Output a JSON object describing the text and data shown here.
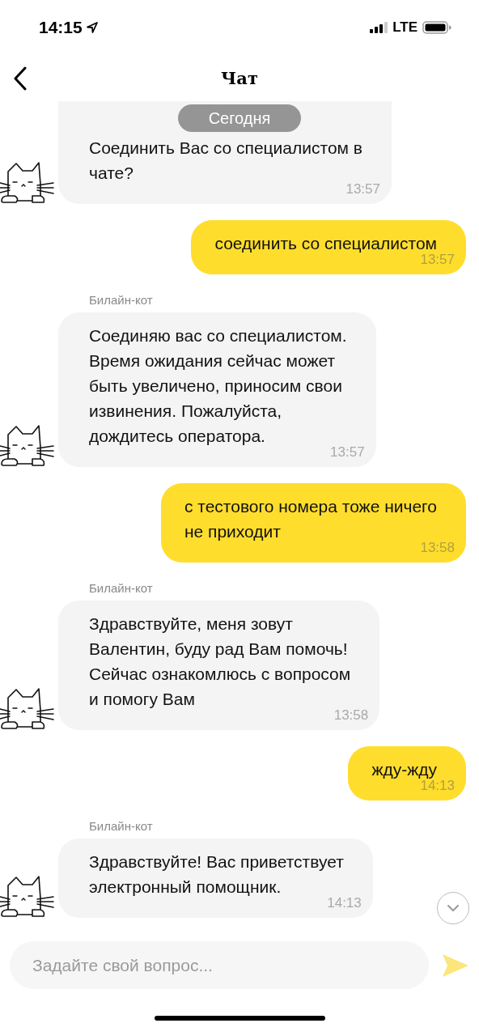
{
  "status_bar": {
    "time": "14:15",
    "network": "LTE"
  },
  "header": {
    "title": "Чат"
  },
  "date_pill": "Сегодня",
  "messages": [
    {
      "kind": "incoming",
      "text": "Соединить Вас со специалистом в\nчате?",
      "time": "13:57"
    },
    {
      "kind": "outgoing",
      "text": "соединить со специалистом",
      "time": "13:57"
    },
    {
      "kind": "incoming",
      "author": "Билайн-кот",
      "text": "Соединяю вас со специалистом.\nВремя ожидания сейчас может\nбыть увеличено, приносим свои\nизвинения. Пожалуйста,\nдождитесь оператора.",
      "time": "13:57"
    },
    {
      "kind": "outgoing",
      "text": "с тестового номера тоже ничего\nне приходит",
      "time": "13:58"
    },
    {
      "kind": "incoming",
      "author": "Билайн-кот",
      "text": "Здравствуйте, меня зовут\nВалентин, буду рад Вам помочь!\nСейчас ознакомлюсь с вопросом\nи помогу Вам",
      "time": "13:58"
    },
    {
      "kind": "outgoing",
      "text": "жду-жду",
      "time": "14:13"
    },
    {
      "kind": "incoming",
      "author": "Билайн-кот",
      "text": "Здравствуйте! Вас приветствует\nэлектронный помощник.",
      "time": "14:13"
    }
  ],
  "composer": {
    "placeholder": "Задайте свой вопрос..."
  }
}
